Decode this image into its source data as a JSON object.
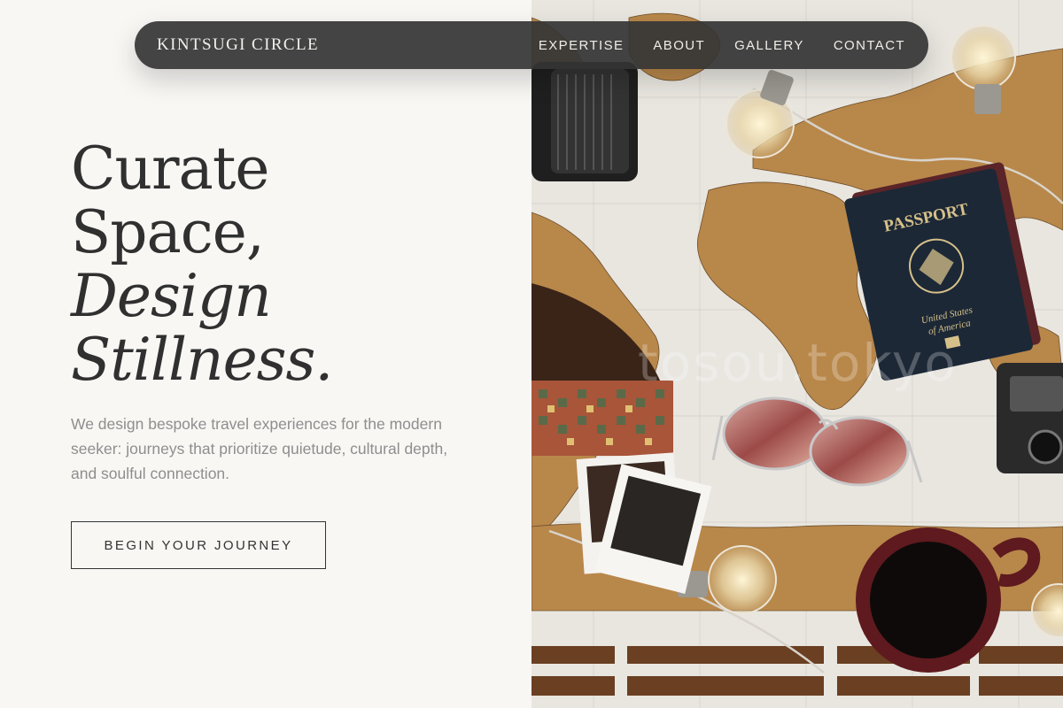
{
  "nav": {
    "brand": "KINTSUGI CIRCLE",
    "links": [
      "EXPERTISE",
      "ABOUT",
      "GALLERY",
      "CONTACT"
    ]
  },
  "hero": {
    "headline": [
      "Curate",
      "Space,",
      "Design",
      "Stillness."
    ],
    "description": "We design bespoke travel experiences for the modern seeker: journeys that prioritize quietude, cultural depth, and soulful connection.",
    "cta_label": "BEGIN YOUR JOURNEY"
  },
  "image": {
    "passport_title": "PASSPORT",
    "passport_country_1": "United States",
    "passport_country_2": "of America",
    "watermark": "tosou.tokyo"
  },
  "colors": {
    "page_bg": "#f8f7f4",
    "nav_bg": "#343434",
    "headline": "#303030",
    "body_text": "#8e8e8e",
    "map_land": "#b8874a",
    "passport": "#1c2836"
  }
}
